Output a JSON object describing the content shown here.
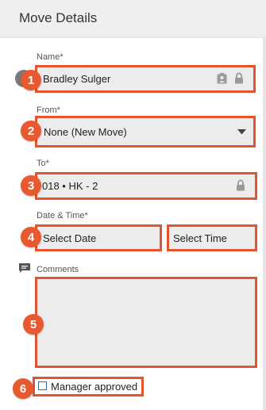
{
  "header": {
    "title": "Move Details"
  },
  "form": {
    "name": {
      "label": "Name*",
      "value": "Bradley Sulger",
      "badge": "1"
    },
    "from": {
      "label": "From*",
      "value": "None (New Move)",
      "badge": "2"
    },
    "to": {
      "label": "To*",
      "value": "018 • HK - 2",
      "badge": "3"
    },
    "datetime": {
      "label": "Date & Time*",
      "date_value": "Select Date",
      "time_value": "Select Time",
      "badge": "4"
    },
    "comments": {
      "label": "Comments",
      "value": "",
      "badge": "5"
    },
    "manager_approved": {
      "label": "Manager approved",
      "checked": false,
      "badge": "6"
    }
  },
  "colors": {
    "highlight": "#e2552e",
    "badge": "#e8592f",
    "field_bg": "#ececec",
    "checkbox_border": "#2a6fb0"
  },
  "icons": [
    "contact-card-icon",
    "lock-icon",
    "dropdown-caret-icon",
    "comment-icon"
  ]
}
